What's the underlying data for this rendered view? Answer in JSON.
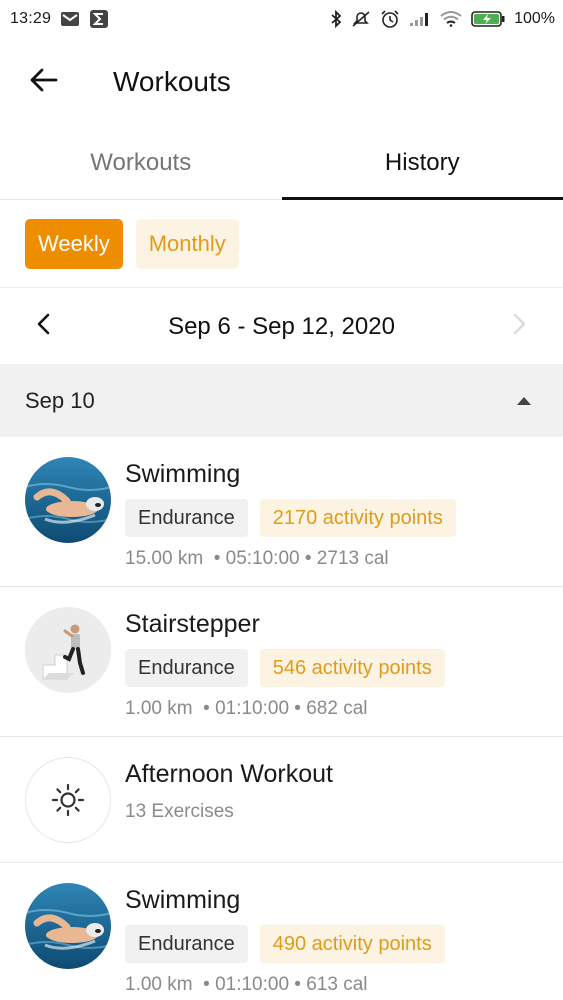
{
  "status_bar": {
    "time": "13:29",
    "battery": "100%",
    "icons": [
      "gmail-icon",
      "sigma-app-icon",
      "bluetooth-icon",
      "mute-icon",
      "alarm-icon",
      "signal-icon",
      "wifi-icon",
      "battery-charging-icon"
    ]
  },
  "app_bar": {
    "title": "Workouts",
    "back_icon": "arrow-left-icon"
  },
  "tabs": [
    {
      "label": "Workouts",
      "active": false
    },
    {
      "label": "History",
      "active": true
    }
  ],
  "period": {
    "options": [
      "Weekly",
      "Monthly"
    ],
    "selected": "Weekly"
  },
  "date_range": {
    "label": "Sep 6 - Sep 12, 2020",
    "prev_icon": "chevron-left-icon",
    "next_icon": "chevron-right-icon",
    "next_disabled": true
  },
  "day_group": {
    "label": "Sep 10",
    "toggle_icon": "caret-up-icon"
  },
  "workouts": [
    {
      "title": "Swimming",
      "category": "Endurance",
      "points": "2170 activity points",
      "meta": "15.00 km  • 05:10:00 • 2713 cal",
      "thumb": "swimmer"
    },
    {
      "title": "Stairstepper",
      "category": "Endurance",
      "points": "546 activity points",
      "meta": "1.00 km  • 01:10:00 • 682 cal",
      "thumb": "stairs"
    },
    {
      "title": "Afternoon Workout",
      "sub": "13 Exercises",
      "thumb": "sun-icon"
    },
    {
      "title": "Swimming",
      "category": "Endurance",
      "points": "490 activity points",
      "meta": "1.00 km  • 01:10:00 • 613 cal",
      "thumb": "swimmer"
    }
  ],
  "colors": {
    "accent": "#ef8d00",
    "accent_soft": "#fdf3e3",
    "accent_text": "#e19b1b"
  }
}
